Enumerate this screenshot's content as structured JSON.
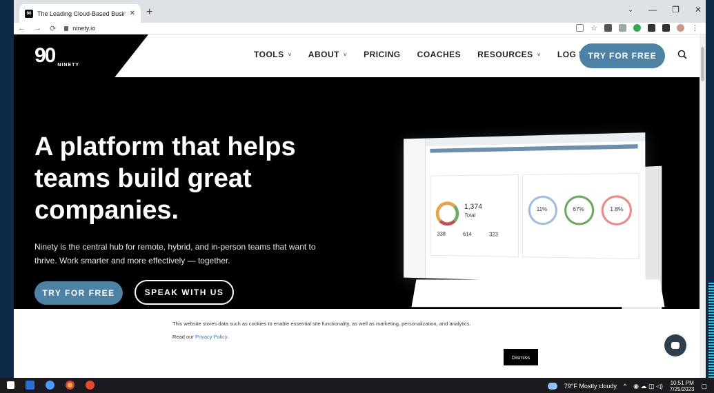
{
  "browser": {
    "tab_title": "The Leading Cloud-Based Busine",
    "tab_favicon": "90",
    "url": "ninety.io"
  },
  "site": {
    "logo": "90",
    "logo_word": "NINETY",
    "nav": [
      {
        "label": "TOOLS",
        "dropdown": true
      },
      {
        "label": "ABOUT",
        "dropdown": true
      },
      {
        "label": "PRICING",
        "dropdown": false
      },
      {
        "label": "COACHES",
        "dropdown": false
      },
      {
        "label": "RESOURCES",
        "dropdown": true
      },
      {
        "label": "LOG IN",
        "dropdown": false
      }
    ],
    "cta": "TRY FOR FREE"
  },
  "hero": {
    "headline": "A platform that helps teams build great companies.",
    "subtext": "Ninety is the central hub for remote, hybrid, and in-person teams that want to thrive. Work smarter and more effectively — together.",
    "primary_button": "TRY FOR FREE",
    "secondary_button": "SPEAK WITH US",
    "mock_total": "1,374",
    "mock_total_label": "Total",
    "mock_stats": [
      "338",
      "614",
      "323"
    ],
    "mock_rings": [
      "11%",
      "67%",
      "1.8%"
    ]
  },
  "cookie": {
    "message": "This website stores data such as cookies to enable essential site functionality, as well as marketing, personalization, and analytics.",
    "read_prefix": "Read our ",
    "policy_link": "Privacy Policy",
    "read_suffix": ".",
    "dismiss": "Dismiss"
  },
  "taskbar": {
    "weather": "79°F  Mostly cloudy",
    "time": "10:51 PM",
    "date": "7/25/2023"
  },
  "colors": {
    "accent": "#4e82a5",
    "hero_bg": "#000000"
  }
}
